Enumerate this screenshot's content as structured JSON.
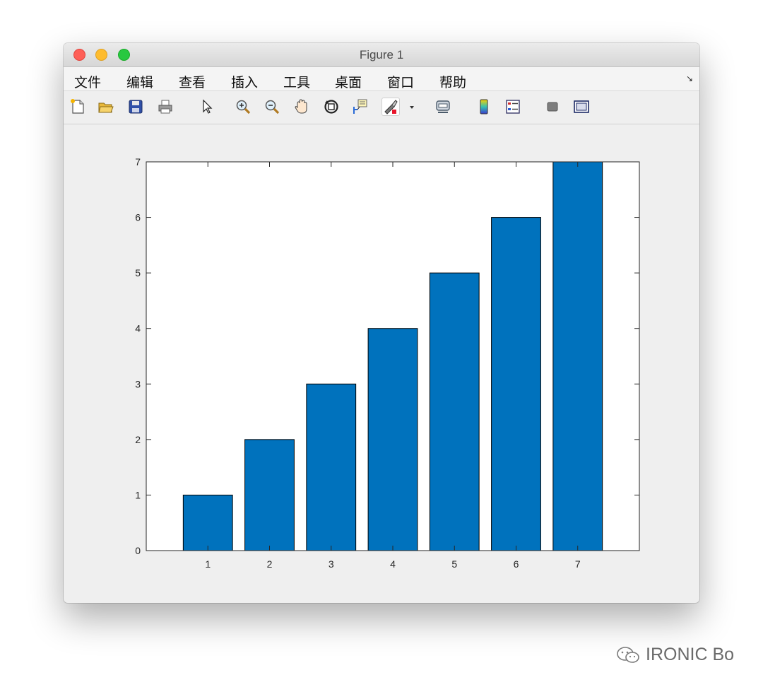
{
  "window": {
    "title": "Figure 1"
  },
  "menu": [
    "文件",
    "编辑",
    "查看",
    "插入",
    "工具",
    "桌面",
    "窗口",
    "帮助"
  ],
  "menu_overflow_icon": "corner-arrow-icon",
  "toolbar": {
    "icons": [
      "new-figure-icon",
      "open-file-icon",
      "save-icon",
      "print-icon",
      "edit-plot-arrow-icon",
      "zoom-in-icon",
      "zoom-out-icon",
      "pan-hand-icon",
      "rotate-3d-icon",
      "data-cursor-icon",
      "brush-icon",
      "brush-dropdown-icon",
      "link-plot-icon",
      "colorbar-icon",
      "legend-icon",
      "hide-plot-tools-icon",
      "show-plot-tools-icon"
    ]
  },
  "chart_data": {
    "type": "bar",
    "categories": [
      "1",
      "2",
      "3",
      "4",
      "5",
      "6",
      "7"
    ],
    "values": [
      1,
      2,
      3,
      4,
      5,
      6,
      7
    ],
    "yticks": [
      "0",
      "1",
      "2",
      "3",
      "4",
      "5",
      "6",
      "7"
    ],
    "ylim": [
      0,
      7
    ],
    "xlim": [
      0,
      8
    ],
    "title": "",
    "xlabel": "",
    "ylabel": "",
    "bar_color": "#0072bd",
    "grid": false,
    "legend": "none"
  },
  "watermark": {
    "text": "IRONIC Bo",
    "icon": "wechat-icon"
  }
}
